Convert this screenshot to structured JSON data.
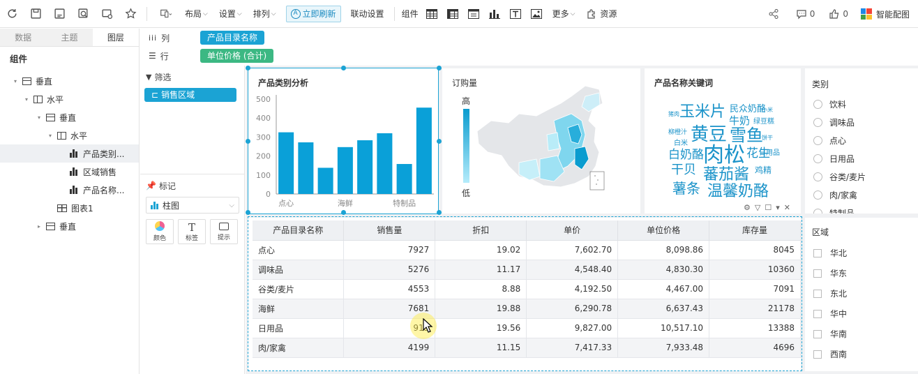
{
  "toolbar": {
    "layout": "布局",
    "settings": "设置",
    "arrange": "排列",
    "refresh": "立即刷新",
    "linkage": "联动设置",
    "components": "组件",
    "more": "更多",
    "resources": "资源",
    "comment_count": "0",
    "like_count": "0",
    "smart": "智能配图"
  },
  "left": {
    "tabs": [
      "数据",
      "主题",
      "图层"
    ],
    "section_title": "组件",
    "tree": [
      {
        "label": "垂直",
        "type": "v"
      },
      {
        "label": "水平",
        "type": "h"
      },
      {
        "label": "垂直",
        "type": "v"
      },
      {
        "label": "水平",
        "type": "h"
      },
      {
        "label": "产品类别...",
        "type": "bar"
      },
      {
        "label": "区域销售",
        "type": "bar"
      },
      {
        "label": "产品名称...",
        "type": "bar"
      },
      {
        "label": "图表1",
        "type": "tbl"
      },
      {
        "label": "垂直",
        "type": "v"
      }
    ]
  },
  "shelf": {
    "col_label": "列",
    "row_label": "行",
    "col_pill": "产品目录名称",
    "row_pill": "单位价格 (合计)"
  },
  "filter": {
    "title": "筛选",
    "pill": "销售区域",
    "mark_title": "标记",
    "chart_type": "柱图",
    "color": "颜色",
    "label": "标签",
    "tip": "提示"
  },
  "chart_data": {
    "type": "bar",
    "title": "产品类别分析",
    "ylim": [
      0,
      500
    ],
    "yticks": [
      "0",
      "100",
      "200",
      "300",
      "400",
      "500"
    ],
    "xtick_labels": [
      "点心",
      "海鲜",
      "特制品"
    ],
    "values": [
      325,
      272,
      138,
      247,
      283,
      320,
      158,
      455
    ],
    "color": "#0aa0d8"
  },
  "map": {
    "title": "订购量",
    "legend_high": "高",
    "legend_low": "低"
  },
  "wordcloud": {
    "title": "产品名称关键词",
    "words": [
      "玉米片",
      "民众奶酪",
      "牛奶",
      "绿豆糕",
      "黄豆",
      "雪鱼",
      "柳橙汁",
      "白米",
      "白奶酪",
      "肉松",
      "花生",
      "干贝",
      "日用品",
      "蕃茄酱",
      "鸡精",
      "薯条",
      "温馨奶酪",
      "猪肉",
      "小米",
      "饼干"
    ]
  },
  "category": {
    "title": "类别",
    "items": [
      "饮料",
      "调味品",
      "点心",
      "日用品",
      "谷类/麦片",
      "肉/家禽",
      "特制品"
    ]
  },
  "region": {
    "title": "区域",
    "items": [
      "华北",
      "华东",
      "东北",
      "华中",
      "华南",
      "西南"
    ]
  },
  "table": {
    "headers": [
      "产品目录名称",
      "销售量",
      "折扣",
      "单价",
      "单位价格",
      "库存量"
    ],
    "rows": [
      [
        "点心",
        "7927",
        "19.02",
        "7,602.70",
        "8,098.86",
        "8045"
      ],
      [
        "调味品",
        "5276",
        "11.17",
        "4,548.40",
        "4,830.30",
        "10360"
      ],
      [
        "谷类/麦片",
        "4553",
        "8.88",
        "4,192.50",
        "4,467.00",
        "7091"
      ],
      [
        "海鲜",
        "7681",
        "19.88",
        "6,290.78",
        "6,637.43",
        "21178"
      ],
      [
        "日用品",
        "913",
        "19.56",
        "9,827.00",
        "10,517.10",
        "13388"
      ],
      [
        "肉/家禽",
        "4199",
        "11.15",
        "7,417.33",
        "7,933.48",
        "4696"
      ]
    ]
  }
}
